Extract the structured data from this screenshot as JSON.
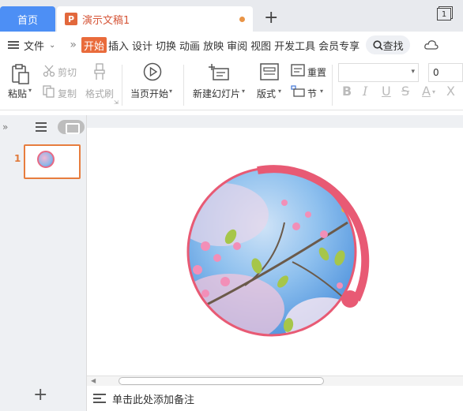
{
  "tabs": {
    "home": "首页",
    "doc_icon": "P",
    "doc_title": "演示文稿1",
    "add": "+",
    "window_count": "1"
  },
  "menu": {
    "file": "文件",
    "more": "»",
    "items": [
      "开始",
      "插入",
      "设计",
      "切换",
      "动画",
      "放映",
      "审阅",
      "视图",
      "开发工具",
      "会员专享"
    ],
    "search": "查找"
  },
  "ribbon": {
    "paste": "粘贴",
    "cut": "剪切",
    "copy": "复制",
    "format_painter": "格式刷",
    "from_current": "当页开始",
    "new_slide": "新建幻灯片",
    "layout": "版式",
    "reset": "重置",
    "section": "节",
    "font_name": "",
    "font_size": "0",
    "format_buttons": [
      "B",
      "I",
      "U",
      "S",
      "A",
      "X"
    ]
  },
  "left_panel": {
    "slide_number": "1",
    "add_label": "+"
  },
  "slide": {
    "image_desc": "circle"
  },
  "notes": {
    "placeholder": "单击此处添加备注"
  },
  "colors": {
    "accent": "#e96b3b",
    "ring": "#e85a74",
    "home_tab": "#4d8ff5"
  }
}
